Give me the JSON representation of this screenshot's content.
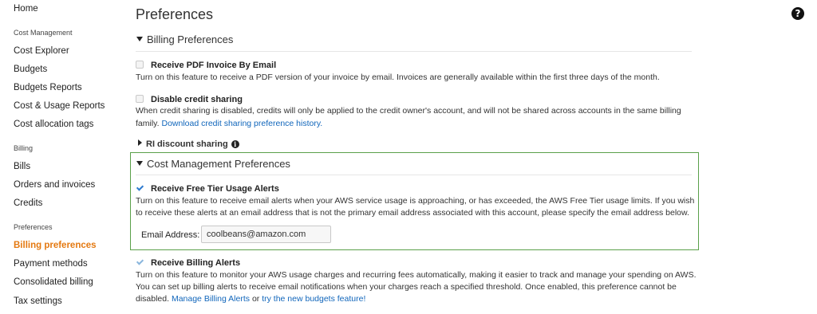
{
  "sidebar": {
    "home": "Home",
    "sections": [
      {
        "title": "Cost Management",
        "items": [
          "Cost Explorer",
          "Budgets",
          "Budgets Reports",
          "Cost & Usage Reports",
          "Cost allocation tags"
        ]
      },
      {
        "title": "Billing",
        "items": [
          "Bills",
          "Orders and invoices",
          "Credits"
        ]
      },
      {
        "title": "Preferences",
        "items": [
          "Billing preferences",
          "Payment methods",
          "Consolidated billing",
          "Tax settings"
        ]
      }
    ],
    "active_item": "Billing preferences"
  },
  "page": {
    "title": "Preferences",
    "help_icon": "question-circle-icon"
  },
  "billing_preferences": {
    "heading": "Billing Preferences",
    "pdf_invoice": {
      "label": "Receive PDF Invoice By Email",
      "checked": false,
      "description": "Turn on this feature to receive a PDF version of your invoice by email. Invoices are generally available within the first three days of the month."
    },
    "credit_sharing": {
      "label": "Disable credit sharing",
      "checked": false,
      "description_line1": "When credit sharing is disabled, credits will only be applied to the credit owner's account, and will not be shared across accounts in the same billing",
      "description_line2": "family.",
      "history_link": "Download credit sharing preference history."
    },
    "ri_discount": {
      "label": "RI discount sharing",
      "icon": "info-icon"
    }
  },
  "cost_management_preferences": {
    "heading": "Cost Management Preferences",
    "free_tier": {
      "label": "Receive Free Tier Usage Alerts",
      "checked": true,
      "description_line1": "Turn on this feature to receive email alerts when your AWS service usage is approaching, or has exceeded, the AWS Free Tier usage limits. If you wish",
      "description_line2": "to receive these alerts at an email address that is not the primary email address associated with this account, please specify the email address below."
    },
    "email": {
      "label": "Email Address:",
      "value": "coolbeans@amazon.com"
    }
  },
  "billing_alerts": {
    "label": "Receive Billing Alerts",
    "checked": true,
    "description_line1": "Turn on this feature to monitor your AWS usage charges and recurring fees automatically, making it easier to track and manage your spending on AWS.",
    "description_line2": "You can set up billing alerts to receive email notifications when your charges reach a specified threshold. Once enabled, this preference cannot be",
    "description_line3_prefix": "disabled.",
    "manage_link": "Manage Billing Alerts",
    "or_text": "or",
    "budgets_link": "try the new budgets feature!"
  },
  "colors": {
    "accent_orange": "#e47911",
    "link_blue": "#1166bb",
    "highlight_green": "#5aa04a"
  }
}
